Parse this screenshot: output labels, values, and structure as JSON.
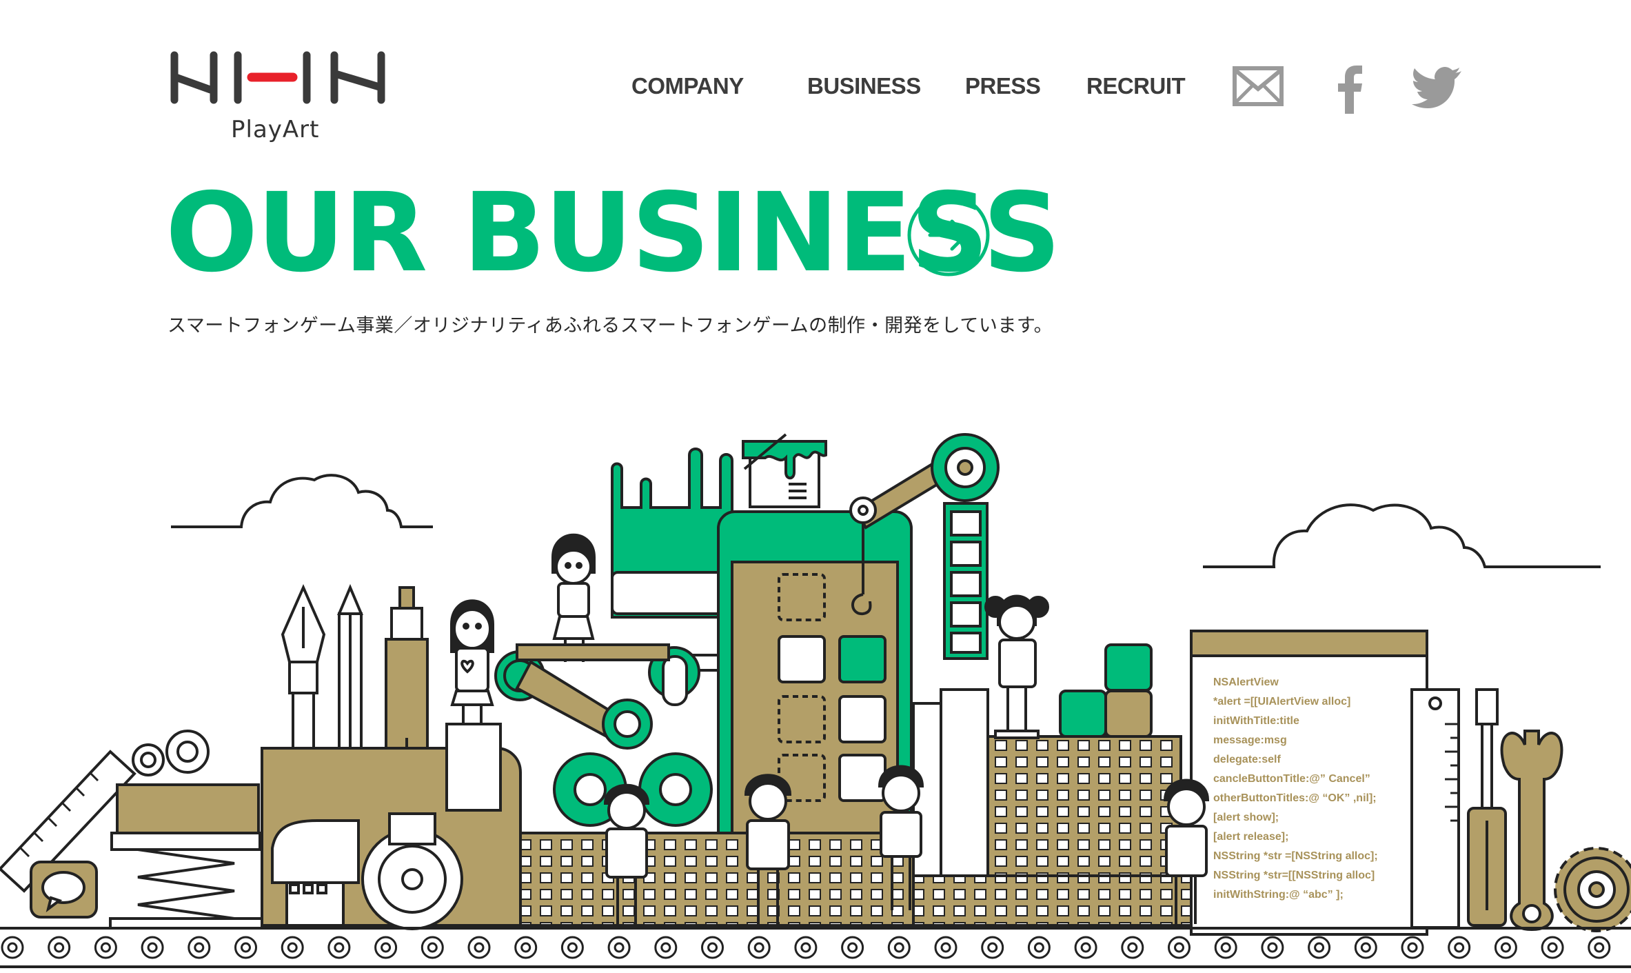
{
  "brand": {
    "name": "NHN",
    "subtitle": "PlayArt",
    "accent_color": "#e8212a",
    "logo_color": "#3a3a3a"
  },
  "nav": {
    "items": [
      {
        "label": "COMPANY"
      },
      {
        "label": "BUSINESS"
      },
      {
        "label": "PRESS"
      },
      {
        "label": "RECRUIT"
      }
    ],
    "social": [
      {
        "icon": "mail-icon"
      },
      {
        "icon": "facebook-icon"
      },
      {
        "icon": "twitter-icon"
      }
    ],
    "icon_color": "#9a9a9a"
  },
  "hero": {
    "title": "OUR BUSINESS",
    "title_color": "#00bb7a",
    "arrow_icon": "arrow-right-circle-icon",
    "description": "スマートフォンゲーム事業／オリジナリティあふれるスマートフォンゲームの制作・開発をしています。"
  },
  "illustration": {
    "colors": {
      "green": "#00bb7a",
      "tan": "#b39f68",
      "outline": "#222222"
    },
    "code_lines": [
      "NSAlertView",
      "*alert =[[UIAlertView alloc]",
      "initWithTitle:title",
      "message:msg",
      "delegate:self",
      "cancleButtonTitle:@” Cancel”",
      "otherButtonTitles:@ “OK” ,nil];",
      "[alert show];",
      "[alert release];",
      "NSString *str =[NSString alloc];",
      "NSString *str=[[NSString alloc]",
      "initWithString:@ “abc” ];"
    ]
  }
}
